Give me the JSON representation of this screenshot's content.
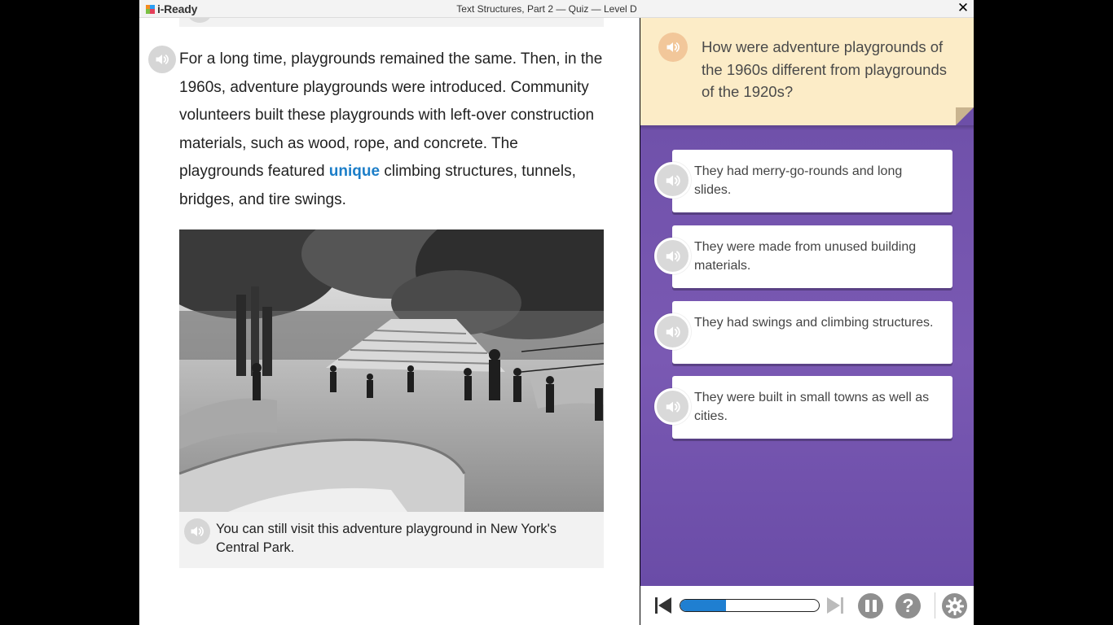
{
  "app": {
    "logo_text": "i-Ready",
    "window_title": "Text Structures, Part 2 — Quiz — Level D",
    "close_symbol": "✕"
  },
  "passage": {
    "text_before": "For a long time, playgrounds remained the same. Then, in the 1960s, adventure playgrounds were introduced. Community volunteers built these playgrounds with left-over construction materials, such as wood, rope, and concrete. The playgrounds featured ",
    "vocab_word": "unique",
    "text_after": " climbing structures, tunnels, bridges, and tire swings.",
    "audio_icon": "speaker-icon"
  },
  "photo": {
    "description_icon": "photo-adventure-playground"
  },
  "caption": {
    "text": "You can still visit this adventure playground in New York's Central Park."
  },
  "question": {
    "text": "How were adventure playgrounds of the 1960s different from playgrounds of the 1920s?"
  },
  "answers": [
    {
      "text": "They had merry-go-rounds and long slides."
    },
    {
      "text": "They were made from unused building materials."
    },
    {
      "text": "They had swings and climbing structures."
    },
    {
      "text": "They were built in small towns as well as cities."
    }
  ],
  "controls": {
    "progress_percent": 33,
    "help_label": "?"
  },
  "colors": {
    "accent_blue": "#1f7fd1",
    "panel_purple": "#7a59b3",
    "question_bg": "#fcecc7",
    "vocab": "#1c7ec8"
  }
}
